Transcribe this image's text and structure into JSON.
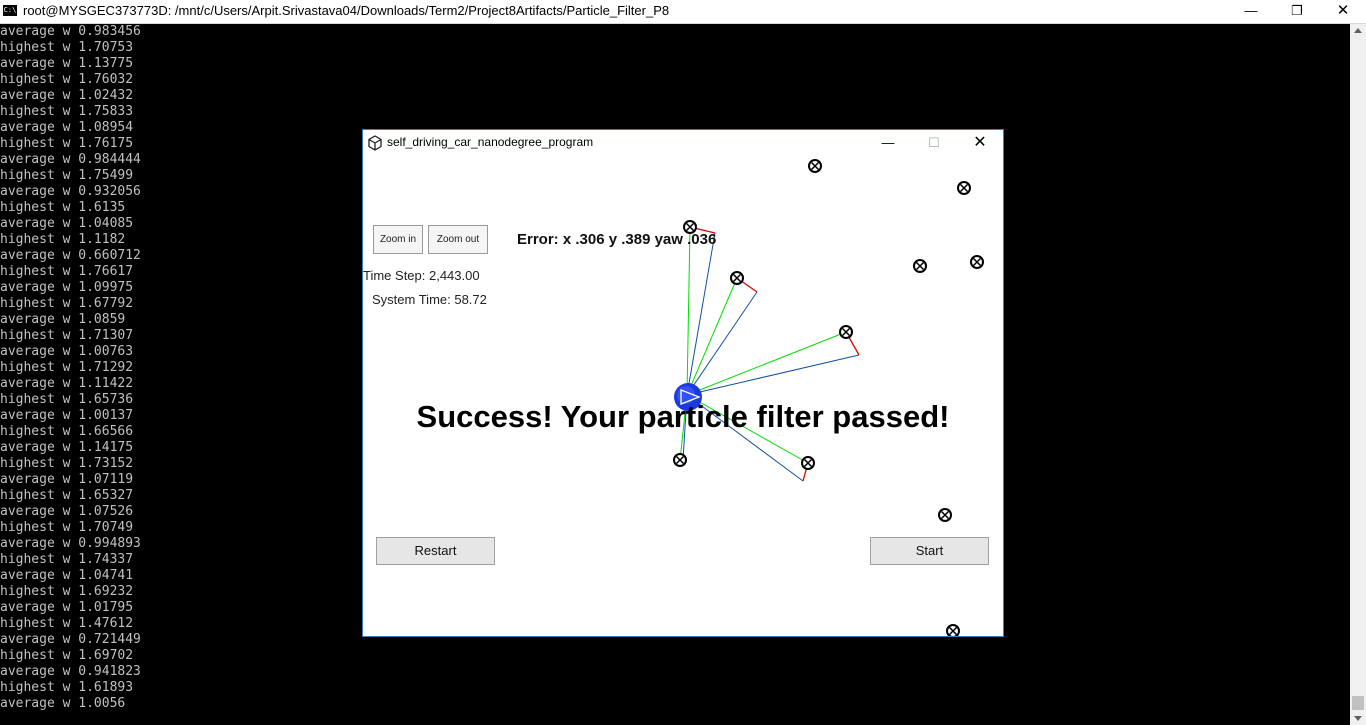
{
  "terminal": {
    "title": "root@MYSGEC373773D: /mnt/c/Users/Arpit.Srivastava04/Downloads/Term2/Project8Artifacts/Particle_Filter_P8",
    "icon": "terminal-icon",
    "lines": [
      "average w 0.983456",
      "highest w 1.70753",
      "average w 1.13775",
      "highest w 1.76032",
      "average w 1.02432",
      "highest w 1.75833",
      "average w 1.08954",
      "highest w 1.76175",
      "average w 0.984444",
      "highest w 1.75499",
      "average w 0.932056",
      "highest w 1.6135",
      "average w 1.04085",
      "highest w 1.1182",
      "average w 0.660712",
      "highest w 1.76617",
      "average w 1.09975",
      "highest w 1.67792",
      "average w 1.0859",
      "highest w 1.71307",
      "average w 1.00763",
      "highest w 1.71292",
      "average w 1.11422",
      "highest w 1.65736",
      "average w 1.00137",
      "highest w 1.66566",
      "average w 1.14175",
      "highest w 1.73152",
      "average w 1.07119",
      "highest w 1.65327",
      "average w 1.07526",
      "highest w 1.70749",
      "average w 0.994893",
      "highest w 1.74337",
      "average w 1.04741",
      "highest w 1.69232",
      "average w 1.01795",
      "highest w 1.47612",
      "average w 0.721449",
      "highest w 1.69702",
      "average w 0.941823",
      "highest w 1.61893",
      "average w 1.0056"
    ],
    "text_color": "#c0c0c0",
    "background": "#000000"
  },
  "simulator": {
    "title": "self_driving_car_nanodegree_program",
    "icon": "unity-icon",
    "zoom_in_label": "Zoom in",
    "zoom_out_label": "Zoom out",
    "time_step": "Time Step: 2,443.00",
    "system_time": "System Time: 58.72",
    "error": "Error: x .306 y .389 yaw .036",
    "success": "Success! Your particle filter passed!",
    "restart_label": "Restart",
    "start_label": "Start",
    "colors": {
      "observation_true": "#00dd00",
      "observation_pred": "#1050a0",
      "offset": "#e00000",
      "car": "#1a3ae0",
      "landmark": "#000000"
    }
  }
}
